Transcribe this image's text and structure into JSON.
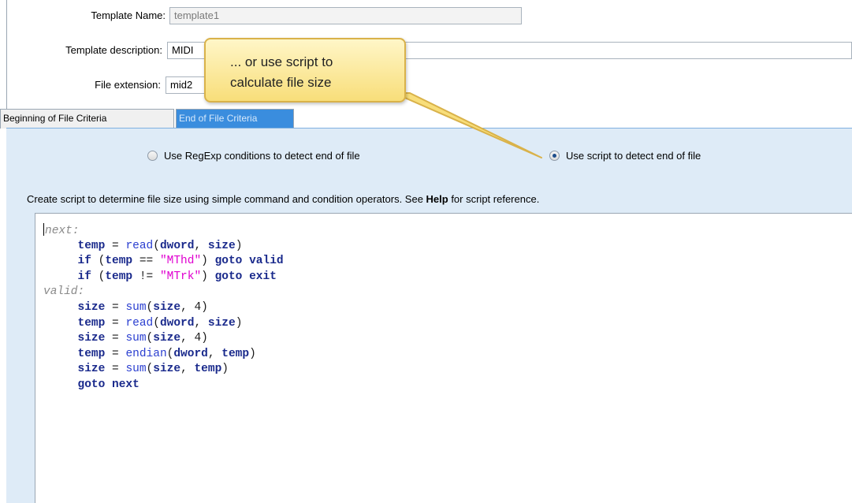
{
  "form": {
    "template_name_label": "Template Name:",
    "template_name_value": "template1",
    "template_description_label": "Template description:",
    "template_description_value": "MIDI",
    "file_extension_label": "File extension:",
    "file_extension_value": "mid2"
  },
  "tabs": [
    {
      "label": "Beginning of File Criteria",
      "active": false
    },
    {
      "label": "End of File Criteria",
      "active": true
    }
  ],
  "radios": [
    {
      "label": "Use RegExp conditions to detect end of file",
      "checked": false
    },
    {
      "label": "Use script to detect end of file",
      "checked": true
    }
  ],
  "hint": {
    "before": "Create script to determine file size using simple command and condition operators. See ",
    "link": "Help",
    "after": " for script reference."
  },
  "script_lines": [
    "next:",
    "     temp = read(dword, size)",
    "     if (temp == \"MThd\") goto valid",
    "     if (temp != \"MTrk\") goto exit",
    "valid:",
    "     size = sum(size, 4)",
    "     temp = read(dword, size)",
    "     size = sum(size, 4)",
    "     temp = endian(dword, temp)",
    "     size = sum(size, temp)",
    "     goto next"
  ],
  "callout": {
    "text_line1": "... or use script to",
    "text_line2": "calculate file size"
  },
  "colors": {
    "tab_active": "#3a8dde",
    "panel_bg": "#deebf7",
    "callout_fill": "#fbe79a",
    "callout_border": "#d9b24a",
    "keyword": "#1a2a8c",
    "function": "#2a3ed0",
    "string": "#e000d0",
    "label": "#8a8a8a"
  }
}
